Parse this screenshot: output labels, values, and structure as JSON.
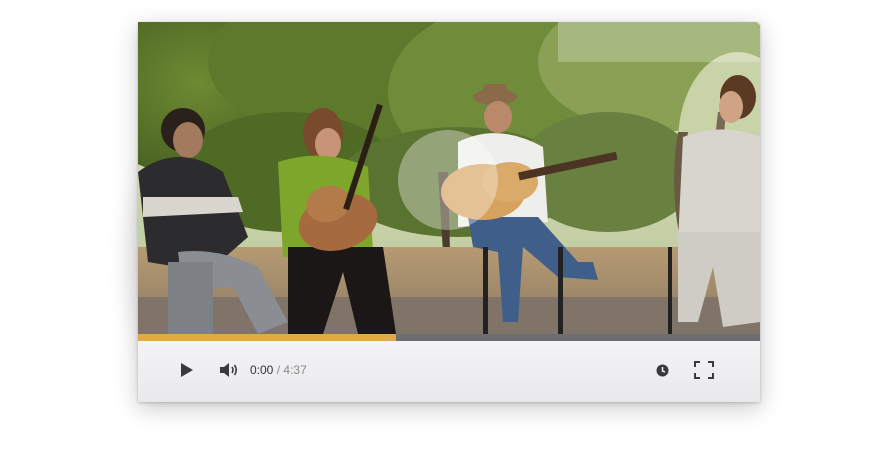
{
  "player": {
    "current_time": "0:00",
    "separator": "/",
    "duration": "4:37",
    "progress_fraction": 0.415,
    "icons": {
      "play": "play-icon",
      "volume": "volume-icon",
      "speed": "clock-icon",
      "fullscreen": "fullscreen-icon",
      "big_play": "big-play-circle"
    },
    "colors": {
      "progress_fill": "#e1a94c",
      "progress_track": "#6d6e71",
      "controls_bg": "#efeff1",
      "icon": "#3a3a3c"
    }
  }
}
